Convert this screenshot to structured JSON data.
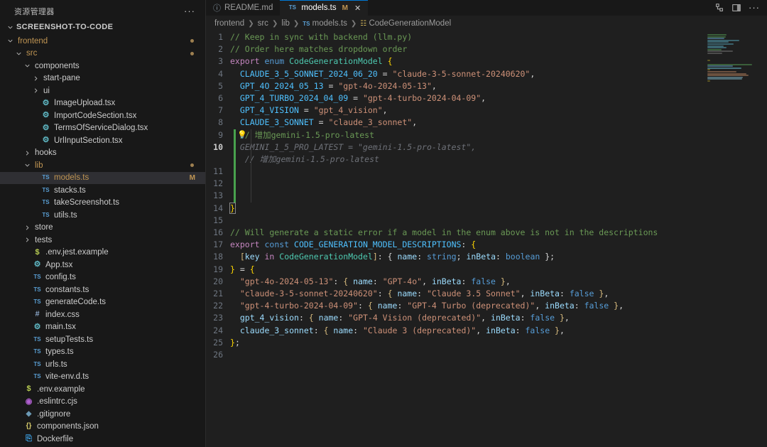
{
  "sidebar": {
    "title": "资源管理器",
    "more_label": "···",
    "root": "SCREENSHOT-TO-CODE",
    "items": [
      {
        "label": "frontend",
        "type": "folder",
        "expanded": true,
        "depth": 1,
        "modified": true,
        "badge": "dot"
      },
      {
        "label": "src",
        "type": "folder",
        "expanded": true,
        "depth": 2,
        "modified": true,
        "badge": "dot"
      },
      {
        "label": "components",
        "type": "folder",
        "expanded": true,
        "depth": 3,
        "modified": false,
        "badge": ""
      },
      {
        "label": "start-pane",
        "type": "folder",
        "expanded": false,
        "depth": 4,
        "modified": false,
        "badge": ""
      },
      {
        "label": "ui",
        "type": "folder",
        "expanded": false,
        "depth": 4,
        "modified": false,
        "badge": ""
      },
      {
        "label": "ImageUpload.tsx",
        "type": "react",
        "depth": 4,
        "modified": false,
        "badge": ""
      },
      {
        "label": "ImportCodeSection.tsx",
        "type": "react",
        "depth": 4,
        "modified": false,
        "badge": ""
      },
      {
        "label": "TermsOfServiceDialog.tsx",
        "type": "react",
        "depth": 4,
        "modified": false,
        "badge": ""
      },
      {
        "label": "UrlInputSection.tsx",
        "type": "react",
        "depth": 4,
        "modified": false,
        "badge": ""
      },
      {
        "label": "hooks",
        "type": "folder",
        "expanded": false,
        "depth": 3,
        "modified": false,
        "badge": ""
      },
      {
        "label": "lib",
        "type": "folder",
        "expanded": true,
        "depth": 3,
        "modified": true,
        "badge": "dot"
      },
      {
        "label": "models.ts",
        "type": "ts",
        "depth": 4,
        "modified": true,
        "badge": "M",
        "selected": true
      },
      {
        "label": "stacks.ts",
        "type": "ts",
        "depth": 4,
        "modified": false,
        "badge": ""
      },
      {
        "label": "takeScreenshot.ts",
        "type": "ts",
        "depth": 4,
        "modified": false,
        "badge": ""
      },
      {
        "label": "utils.ts",
        "type": "ts",
        "depth": 4,
        "modified": false,
        "badge": ""
      },
      {
        "label": "store",
        "type": "folder",
        "expanded": false,
        "depth": 3,
        "modified": false,
        "badge": ""
      },
      {
        "label": "tests",
        "type": "folder",
        "expanded": false,
        "depth": 3,
        "modified": false,
        "badge": ""
      },
      {
        "label": ".env.jest.example",
        "type": "env",
        "depth": 3,
        "modified": false,
        "badge": ""
      },
      {
        "label": "App.tsx",
        "type": "react",
        "depth": 3,
        "modified": false,
        "badge": ""
      },
      {
        "label": "config.ts",
        "type": "ts",
        "depth": 3,
        "modified": false,
        "badge": ""
      },
      {
        "label": "constants.ts",
        "type": "ts",
        "depth": 3,
        "modified": false,
        "badge": ""
      },
      {
        "label": "generateCode.ts",
        "type": "ts",
        "depth": 3,
        "modified": false,
        "badge": ""
      },
      {
        "label": "index.css",
        "type": "css",
        "depth": 3,
        "modified": false,
        "badge": ""
      },
      {
        "label": "main.tsx",
        "type": "react",
        "depth": 3,
        "modified": false,
        "badge": ""
      },
      {
        "label": "setupTests.ts",
        "type": "ts",
        "depth": 3,
        "modified": false,
        "badge": ""
      },
      {
        "label": "types.ts",
        "type": "ts",
        "depth": 3,
        "modified": false,
        "badge": ""
      },
      {
        "label": "urls.ts",
        "type": "ts",
        "depth": 3,
        "modified": false,
        "badge": ""
      },
      {
        "label": "vite-env.d.ts",
        "type": "ts",
        "depth": 3,
        "modified": false,
        "badge": ""
      },
      {
        "label": ".env.example",
        "type": "env",
        "depth": 2,
        "modified": false,
        "badge": ""
      },
      {
        "label": ".eslintrc.cjs",
        "type": "eslint",
        "depth": 2,
        "modified": false,
        "badge": ""
      },
      {
        "label": ".gitignore",
        "type": "git",
        "depth": 2,
        "modified": false,
        "badge": ""
      },
      {
        "label": "components.json",
        "type": "json",
        "depth": 2,
        "modified": false,
        "badge": ""
      },
      {
        "label": "Dockerfile",
        "type": "docker",
        "depth": 2,
        "modified": false,
        "badge": ""
      }
    ]
  },
  "tabs": [
    {
      "label": "README.md",
      "icon": "markdown-icon",
      "active": false,
      "dirty": "",
      "closable": false
    },
    {
      "label": "models.ts",
      "icon": "typescript-icon",
      "active": true,
      "dirty": "M",
      "closable": true,
      "close_label": "✕"
    }
  ],
  "tabbar_actions": [
    {
      "name": "split-editor-icon"
    },
    {
      "name": "layout-panel-icon"
    },
    {
      "name": "more-actions-icon",
      "label": "···"
    }
  ],
  "breadcrumb": [
    {
      "label": "frontend",
      "icon": ""
    },
    {
      "label": "src",
      "icon": ""
    },
    {
      "label": "lib",
      "icon": ""
    },
    {
      "label": "models.ts",
      "icon": "typescript-icon"
    },
    {
      "label": "CodeGenerationModel",
      "icon": "enum-icon"
    }
  ],
  "editor": {
    "filename": "models.ts",
    "current_line": 10,
    "lines": [
      {
        "n": "1",
        "segs": [
          {
            "t": "// Keep in sync with backend (llm.py)",
            "c": "c-comment",
            "indent": 0
          }
        ]
      },
      {
        "n": "2",
        "segs": [
          {
            "t": "// Order here matches dropdown order",
            "c": "c-comment",
            "indent": 0
          }
        ]
      },
      {
        "n": "3",
        "segs": [
          {
            "t": "export ",
            "c": "c-kw"
          },
          {
            "t": "enum ",
            "c": "c-kw2"
          },
          {
            "t": "CodeGenerationModel ",
            "c": "c-type"
          },
          {
            "t": "{",
            "c": "c-brace-y"
          }
        ]
      },
      {
        "n": "4",
        "segs": [
          {
            "t": "  CLAUDE_3_5_SONNET_2024_06_20 ",
            "c": "c-const"
          },
          {
            "t": "= ",
            "c": "c-punct"
          },
          {
            "t": "\"claude-3-5-sonnet-20240620\"",
            "c": "c-str"
          },
          {
            "t": ",",
            "c": "c-punct"
          }
        ]
      },
      {
        "n": "5",
        "segs": [
          {
            "t": "  GPT_4O_2024_05_13 ",
            "c": "c-const"
          },
          {
            "t": "= ",
            "c": "c-punct"
          },
          {
            "t": "\"gpt-4o-2024-05-13\"",
            "c": "c-str"
          },
          {
            "t": ",",
            "c": "c-punct"
          }
        ]
      },
      {
        "n": "6",
        "segs": [
          {
            "t": "  GPT_4_TURBO_2024_04_09 ",
            "c": "c-const"
          },
          {
            "t": "= ",
            "c": "c-punct"
          },
          {
            "t": "\"gpt-4-turbo-2024-04-09\"",
            "c": "c-str"
          },
          {
            "t": ",",
            "c": "c-punct"
          }
        ]
      },
      {
        "n": "7",
        "segs": [
          {
            "t": "  GPT_4_VISION ",
            "c": "c-const"
          },
          {
            "t": "= ",
            "c": "c-punct"
          },
          {
            "t": "\"gpt_4_vision\"",
            "c": "c-str"
          },
          {
            "t": ",",
            "c": "c-punct"
          }
        ]
      },
      {
        "n": "8",
        "segs": [
          {
            "t": "  CLAUDE_3_SONNET ",
            "c": "c-const"
          },
          {
            "t": "= ",
            "c": "c-punct"
          },
          {
            "t": "\"claude_3_sonnet\"",
            "c": "c-str"
          },
          {
            "t": ",",
            "c": "c-punct"
          }
        ]
      },
      {
        "n": "9",
        "segs": [
          {
            "t": "  // 增加gemini-1.5-pro-latest",
            "c": "c-comment"
          }
        ],
        "changed": true,
        "bulb": true
      },
      {
        "n": "10",
        "segs": [
          {
            "t": "  GEMINI_1_5_PRO_LATEST = \"gemini-1.5-pro-latest\",",
            "c": "c-ghost"
          }
        ],
        "changed": true,
        "current": true
      },
      {
        "n": "",
        "segs": [
          {
            "t": "   // 增加gemini-1.5-pro-latest",
            "c": "c-ghost"
          }
        ],
        "changed": true
      },
      {
        "n": "11",
        "segs": [],
        "changed": true
      },
      {
        "n": "12",
        "segs": [],
        "changed": true
      },
      {
        "n": "13",
        "segs": [],
        "changed": true
      },
      {
        "n": "14",
        "segs": [
          {
            "t": "}",
            "c": "c-brace-y",
            "boxed": true
          }
        ]
      },
      {
        "n": "15",
        "segs": []
      },
      {
        "n": "16",
        "segs": [
          {
            "t": "// Will generate a static error if a model in the enum above is not in the descriptions",
            "c": "c-comment"
          }
        ]
      },
      {
        "n": "17",
        "segs": [
          {
            "t": "export ",
            "c": "c-kw"
          },
          {
            "t": "const ",
            "c": "c-kw2"
          },
          {
            "t": "CODE_GENERATION_MODEL_DESCRIPTIONS",
            "c": "c-const"
          },
          {
            "t": ": ",
            "c": "c-punct"
          },
          {
            "t": "{",
            "c": "c-brace-y"
          }
        ]
      },
      {
        "n": "18",
        "segs": [
          {
            "t": "  [",
            "c": "c-brace1"
          },
          {
            "t": "key ",
            "c": "c-prop"
          },
          {
            "t": "in ",
            "c": "c-kw"
          },
          {
            "t": "CodeGenerationModel",
            "c": "c-type"
          },
          {
            "t": "]",
            "c": "c-brace1"
          },
          {
            "t": ": ",
            "c": "c-punct"
          },
          {
            "t": "{ ",
            "c": "c-plain"
          },
          {
            "t": "name",
            "c": "c-prop"
          },
          {
            "t": ": ",
            "c": "c-punct"
          },
          {
            "t": "string",
            "c": "c-kw2"
          },
          {
            "t": "; ",
            "c": "c-punct"
          },
          {
            "t": "inBeta",
            "c": "c-prop"
          },
          {
            "t": ": ",
            "c": "c-punct"
          },
          {
            "t": "boolean",
            "c": "c-kw2"
          },
          {
            "t": " };",
            "c": "c-plain"
          }
        ]
      },
      {
        "n": "19",
        "segs": [
          {
            "t": "}",
            "c": "c-brace-y"
          },
          {
            "t": " = ",
            "c": "c-punct"
          },
          {
            "t": "{",
            "c": "c-brace-y"
          }
        ]
      },
      {
        "n": "20",
        "segs": [
          {
            "t": "  \"gpt-4o-2024-05-13\"",
            "c": "c-str"
          },
          {
            "t": ": ",
            "c": "c-punct"
          },
          {
            "t": "{ ",
            "c": "c-brace1"
          },
          {
            "t": "name",
            "c": "c-prop"
          },
          {
            "t": ": ",
            "c": "c-punct"
          },
          {
            "t": "\"GPT-4o\"",
            "c": "c-str"
          },
          {
            "t": ", ",
            "c": "c-punct"
          },
          {
            "t": "inBeta",
            "c": "c-prop"
          },
          {
            "t": ": ",
            "c": "c-punct"
          },
          {
            "t": "false",
            "c": "c-bool"
          },
          {
            "t": " }",
            "c": "c-brace1"
          },
          {
            "t": ",",
            "c": "c-punct"
          }
        ]
      },
      {
        "n": "21",
        "segs": [
          {
            "t": "  \"claude-3-5-sonnet-20240620\"",
            "c": "c-str"
          },
          {
            "t": ": ",
            "c": "c-punct"
          },
          {
            "t": "{ ",
            "c": "c-brace1"
          },
          {
            "t": "name",
            "c": "c-prop"
          },
          {
            "t": ": ",
            "c": "c-punct"
          },
          {
            "t": "\"Claude 3.5 Sonnet\"",
            "c": "c-str"
          },
          {
            "t": ", ",
            "c": "c-punct"
          },
          {
            "t": "inBeta",
            "c": "c-prop"
          },
          {
            "t": ": ",
            "c": "c-punct"
          },
          {
            "t": "false",
            "c": "c-bool"
          },
          {
            "t": " }",
            "c": "c-brace1"
          },
          {
            "t": ",",
            "c": "c-punct"
          }
        ]
      },
      {
        "n": "22",
        "segs": [
          {
            "t": "  \"gpt-4-turbo-2024-04-09\"",
            "c": "c-str"
          },
          {
            "t": ": ",
            "c": "c-punct"
          },
          {
            "t": "{ ",
            "c": "c-brace1"
          },
          {
            "t": "name",
            "c": "c-prop"
          },
          {
            "t": ": ",
            "c": "c-punct"
          },
          {
            "t": "\"GPT-4 Turbo (deprecated)\"",
            "c": "c-str"
          },
          {
            "t": ", ",
            "c": "c-punct"
          },
          {
            "t": "inBeta",
            "c": "c-prop"
          },
          {
            "t": ": ",
            "c": "c-punct"
          },
          {
            "t": "false",
            "c": "c-bool"
          },
          {
            "t": " }",
            "c": "c-brace1"
          },
          {
            "t": ",",
            "c": "c-punct"
          }
        ]
      },
      {
        "n": "23",
        "segs": [
          {
            "t": "  gpt_4_vision",
            "c": "c-prop"
          },
          {
            "t": ": ",
            "c": "c-punct"
          },
          {
            "t": "{ ",
            "c": "c-brace1"
          },
          {
            "t": "name",
            "c": "c-prop"
          },
          {
            "t": ": ",
            "c": "c-punct"
          },
          {
            "t": "\"GPT-4 Vision (deprecated)\"",
            "c": "c-str"
          },
          {
            "t": ", ",
            "c": "c-punct"
          },
          {
            "t": "inBeta",
            "c": "c-prop"
          },
          {
            "t": ": ",
            "c": "c-punct"
          },
          {
            "t": "false",
            "c": "c-bool"
          },
          {
            "t": " }",
            "c": "c-brace1"
          },
          {
            "t": ",",
            "c": "c-punct"
          }
        ]
      },
      {
        "n": "24",
        "segs": [
          {
            "t": "  claude_3_sonnet",
            "c": "c-prop"
          },
          {
            "t": ": ",
            "c": "c-punct"
          },
          {
            "t": "{ ",
            "c": "c-brace1"
          },
          {
            "t": "name",
            "c": "c-prop"
          },
          {
            "t": ": ",
            "c": "c-punct"
          },
          {
            "t": "\"Claude 3 (deprecated)\"",
            "c": "c-str"
          },
          {
            "t": ", ",
            "c": "c-punct"
          },
          {
            "t": "inBeta",
            "c": "c-prop"
          },
          {
            "t": ": ",
            "c": "c-punct"
          },
          {
            "t": "false",
            "c": "c-bool"
          },
          {
            "t": " }",
            "c": "c-brace1"
          },
          {
            "t": ",",
            "c": "c-punct"
          }
        ]
      },
      {
        "n": "25",
        "segs": [
          {
            "t": "}",
            "c": "c-brace-y"
          },
          {
            "t": ";",
            "c": "c-punct"
          }
        ]
      },
      {
        "n": "26",
        "segs": []
      }
    ]
  },
  "colors": {
    "editor_bg": "#1f1f1f",
    "sidebar_bg": "#181818",
    "tab_active_bg": "#1f1f1f",
    "accent": "#0078d4",
    "modified": "#c09553",
    "diff_added": "#48a14d"
  }
}
